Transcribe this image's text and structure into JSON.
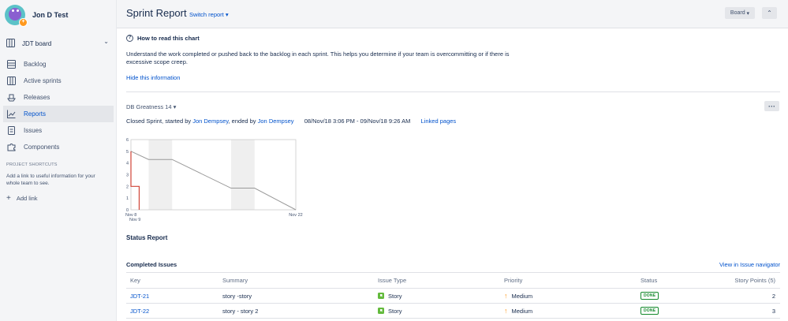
{
  "profile": {
    "name": "Jon D Test"
  },
  "sidebar": {
    "board_label": "JDT board",
    "items": [
      {
        "label": "Backlog",
        "icon": "backlog-icon"
      },
      {
        "label": "Active sprints",
        "icon": "board-icon"
      },
      {
        "label": "Releases",
        "icon": "ship-icon"
      },
      {
        "label": "Reports",
        "icon": "chart-icon",
        "active": true
      },
      {
        "label": "Issues",
        "icon": "issues-icon"
      },
      {
        "label": "Components",
        "icon": "puzzle-icon"
      }
    ],
    "shortcuts_title": "PROJECT SHORTCUTS",
    "shortcuts_text": "Add a link to useful information for your whole team to see.",
    "add_link": "Add link"
  },
  "header": {
    "title": "Sprint Report",
    "switch_report": "Switch report",
    "board_button": "Board"
  },
  "info": {
    "title": "How to read this chart",
    "text": "Understand the work completed or pushed back to the backlog in each sprint. This helps you determine if your team is overcommitting or if there is excessive scope creep.",
    "hide": "Hide this information"
  },
  "sprint": {
    "name": "DB Greatness 14",
    "status_prefix": "Closed Sprint, started by",
    "started_by": "Jon Dempsey",
    "ended_text": ", ended by",
    "ended_by": "Jon Dempsey",
    "dates": "08/Nov/18 3:06 PM - 09/Nov/18 9:26 AM",
    "linked_pages": "Linked pages"
  },
  "chart_data": {
    "type": "line",
    "title": "",
    "xlabel": "",
    "ylabel": "",
    "ylim": [
      0,
      6
    ],
    "yticks": [
      "0",
      "1",
      "2",
      "3",
      "4",
      "5",
      "6"
    ],
    "xtick_labels": [
      "Nov 8",
      "Nov 9",
      "Nov 22"
    ],
    "x_domain_days": [
      8,
      22
    ],
    "series": [
      {
        "color": "#999999",
        "points": [
          [
            8,
            5
          ],
          [
            9.5,
            4.3
          ],
          [
            11.5,
            4.3
          ],
          [
            16.5,
            1.85
          ],
          [
            18.5,
            1.85
          ],
          [
            22,
            0
          ]
        ]
      },
      {
        "color": "#d04437",
        "points": [
          [
            8,
            5
          ],
          [
            8,
            2
          ],
          [
            8.7,
            2
          ],
          [
            8.7,
            0
          ]
        ]
      }
    ],
    "shaded_ranges": [
      [
        9.5,
        11.5
      ],
      [
        16.5,
        18.5
      ]
    ]
  },
  "status_report": {
    "title": "Status Report"
  },
  "completed": {
    "title": "Completed Issues",
    "view_link": "View in Issue navigator",
    "columns": {
      "key": "Key",
      "summary": "Summary",
      "type": "Issue Type",
      "priority": "Priority",
      "status": "Status",
      "points": "Story Points (5)"
    },
    "rows": [
      {
        "key": "JDT-21",
        "summary": "story -story",
        "type": "Story",
        "priority": "Medium",
        "status": "DONE",
        "points": "2"
      },
      {
        "key": "JDT-22",
        "summary": "story - story 2",
        "type": "Story",
        "priority": "Medium",
        "status": "DONE",
        "points": "3"
      }
    ]
  }
}
